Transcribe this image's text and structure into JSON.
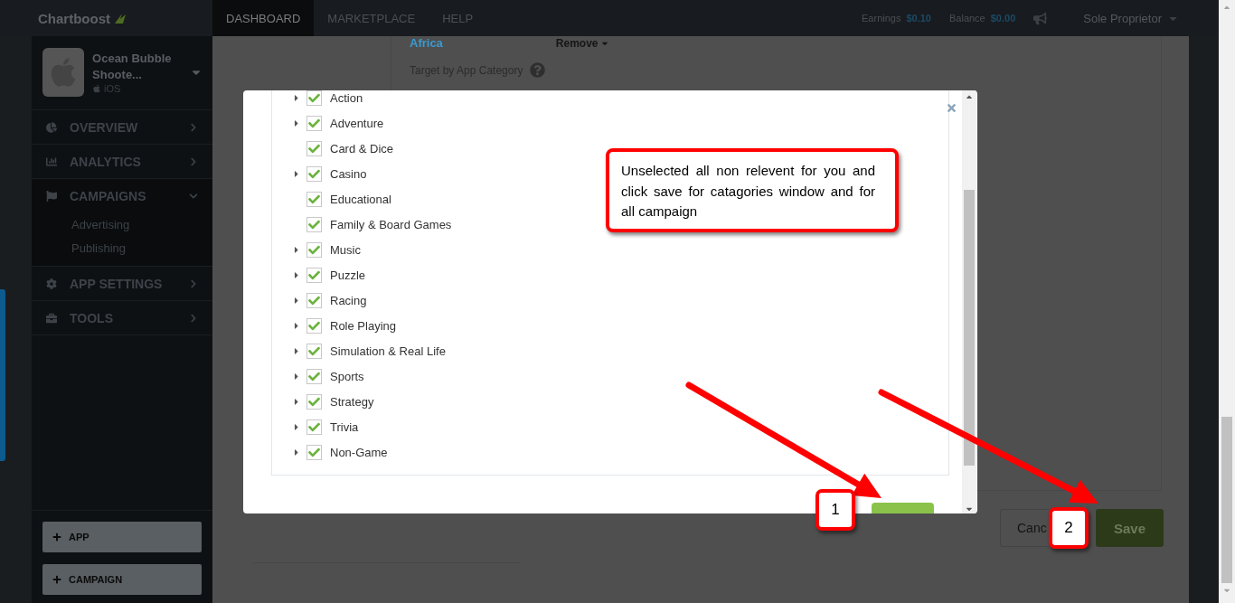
{
  "nav": {
    "brand": "Chartboost",
    "tabs": [
      {
        "label": "DASHBOARD",
        "selected": true
      },
      {
        "label": "MARKETPLACE",
        "selected": false
      },
      {
        "label": "HELP",
        "selected": false
      }
    ],
    "earnings_label": "Earnings",
    "earnings_value": "$0.10",
    "balance_label": "Balance",
    "balance_value": "$0.00",
    "account": "Sole Proprietor"
  },
  "sidebar": {
    "app": {
      "name": "Ocean Bubble Shoote...",
      "platform": "iOS"
    },
    "menu": [
      {
        "label": "OVERVIEW",
        "expanded": false
      },
      {
        "label": "ANALYTICS",
        "expanded": false
      },
      {
        "label": "CAMPAIGNS",
        "expanded": true,
        "children": [
          "Advertising",
          "Publishing"
        ]
      },
      {
        "label": "APP SETTINGS",
        "expanded": false
      },
      {
        "label": "TOOLS",
        "expanded": false
      }
    ],
    "buttons": [
      "APP",
      "CAMPAIGN"
    ]
  },
  "page": {
    "region": "Africa",
    "remove": "Remove",
    "target_label": "Target by App Category",
    "cancel": "Canc",
    "save": "Save"
  },
  "modal": {
    "categories": [
      {
        "label": "Action",
        "checked": true,
        "expandable": true
      },
      {
        "label": "Adventure",
        "checked": true,
        "expandable": true
      },
      {
        "label": "Card & Dice",
        "checked": true,
        "expandable": false
      },
      {
        "label": "Casino",
        "checked": true,
        "expandable": true
      },
      {
        "label": "Educational",
        "checked": true,
        "expandable": false
      },
      {
        "label": "Family & Board Games",
        "checked": true,
        "expandable": false
      },
      {
        "label": "Music",
        "checked": true,
        "expandable": true
      },
      {
        "label": "Puzzle",
        "checked": true,
        "expandable": true
      },
      {
        "label": "Racing",
        "checked": true,
        "expandable": true
      },
      {
        "label": "Role Playing",
        "checked": true,
        "expandable": true
      },
      {
        "label": "Simulation & Real Life",
        "checked": true,
        "expandable": true
      },
      {
        "label": "Sports",
        "checked": true,
        "expandable": true
      },
      {
        "label": "Strategy",
        "checked": true,
        "expandable": true
      },
      {
        "label": "Trivia",
        "checked": true,
        "expandable": true
      },
      {
        "label": "Non-Game",
        "checked": true,
        "expandable": true
      }
    ]
  },
  "annotations": {
    "note": "Unselected all non relevent for you and click save for catagories window and for all campaign",
    "badges": [
      "1",
      "2"
    ]
  }
}
